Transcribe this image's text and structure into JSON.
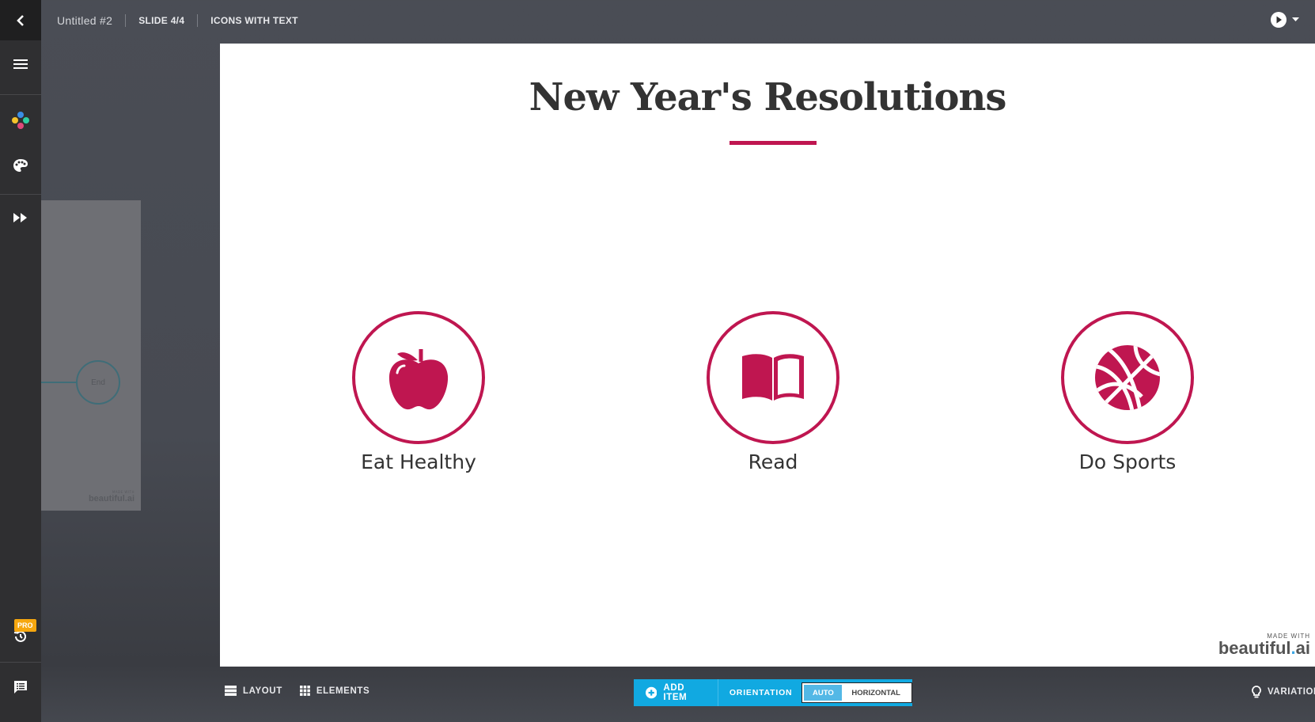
{
  "topbar": {
    "back_icon": "chevron-left-icon",
    "doc_title": "Untitled #2",
    "slide_indicator": "SLIDE 4/4",
    "template_name": "ICONS WITH TEXT",
    "play_icon": "play-circle-icon",
    "play_menu_icon": "caret-down-icon"
  },
  "sidebar": {
    "items": [
      {
        "name": "menu",
        "icon": "hamburger-menu-icon"
      },
      {
        "name": "elements",
        "icon": "color-dots-icon"
      },
      {
        "name": "theme",
        "icon": "palette-icon"
      },
      {
        "name": "animations",
        "icon": "fast-forward-icon"
      },
      {
        "name": "history",
        "icon": "history-icon",
        "badge": "PRO"
      },
      {
        "name": "comments",
        "icon": "comment-list-icon"
      }
    ]
  },
  "thumbnail": {
    "node_label": "End",
    "made_with": "MADE WITH",
    "brand": "beautiful.ai"
  },
  "slide": {
    "title": "New Year's Resolutions",
    "accent_color": "#bf1650",
    "items": [
      {
        "icon": "apple-icon",
        "label": "Eat Healthy"
      },
      {
        "icon": "open-book-icon",
        "label": "Read"
      },
      {
        "icon": "basketball-icon",
        "label": "Do Sports"
      }
    ],
    "made_with": "MADE WITH",
    "brand_main": "beautiful",
    "brand_dot": ".",
    "brand_ai": "ai"
  },
  "bottom_toolbar": {
    "layout_label": "LAYOUT",
    "elements_label": "ELEMENTS",
    "add_item_label": "ADD ITEM",
    "orientation_label": "ORIENTATION",
    "orientation_options": [
      "AUTO",
      "HORIZONTAL"
    ],
    "orientation_selected": "AUTO",
    "variations_label": "VARIATIONS",
    "toolbar_color": "#11a9e1"
  }
}
